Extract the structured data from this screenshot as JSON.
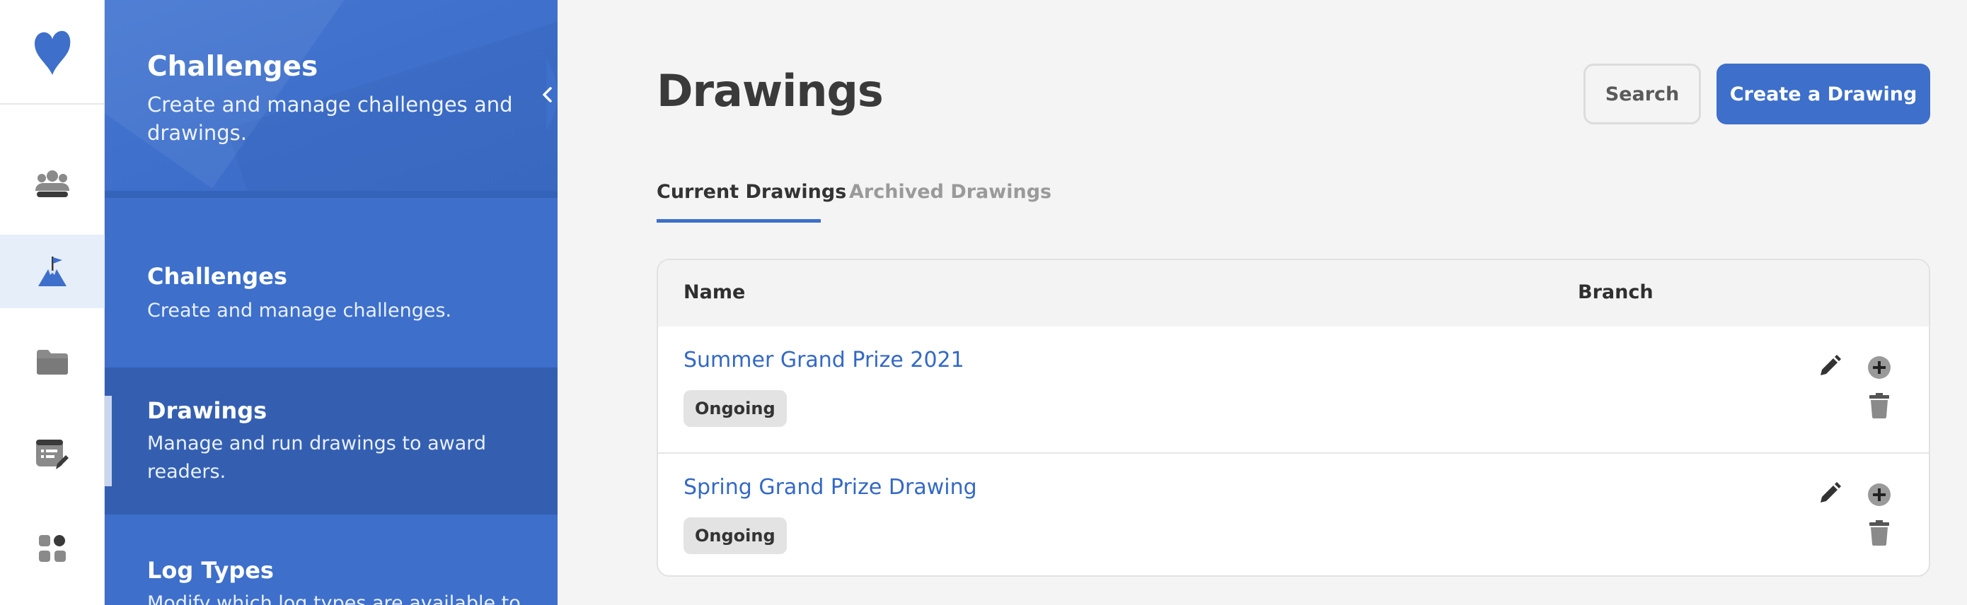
{
  "submenu": {
    "title": "Challenges",
    "description": "Create and manage challenges and drawings.",
    "items": [
      {
        "title": "Challenges",
        "description": "Create and manage challenges."
      },
      {
        "title": "Drawings",
        "description": "Manage and run drawings to award readers."
      },
      {
        "title": "Log Types",
        "description": "Modify which log types are available to"
      }
    ]
  },
  "main": {
    "title": "Drawings",
    "search_label": "Search",
    "create_label": "Create a Drawing",
    "tabs": [
      {
        "label": "Current Drawings",
        "active": true
      },
      {
        "label": "Archived Drawings",
        "active": false
      }
    ],
    "table": {
      "columns": [
        "Name",
        "Branch"
      ],
      "rows": [
        {
          "name": "Summer Grand Prize 2021",
          "status": "Ongoing",
          "branch": ""
        },
        {
          "name": "Spring Grand Prize Drawing",
          "status": "Ongoing",
          "branch": ""
        }
      ]
    }
  },
  "colors": {
    "primary": "#3d6fcb",
    "rail_active": "#e6eefa",
    "link": "#3468c6"
  },
  "icons": {
    "rail": [
      "heart-logo-icon",
      "participants-icon",
      "challenge-flag-icon",
      "folder-icon",
      "report-edit-icon",
      "apps-grid-icon"
    ],
    "row_actions": [
      "pencil-icon",
      "plus-circle-icon",
      "trash-icon"
    ],
    "collapse": "chevron-left-icon"
  }
}
